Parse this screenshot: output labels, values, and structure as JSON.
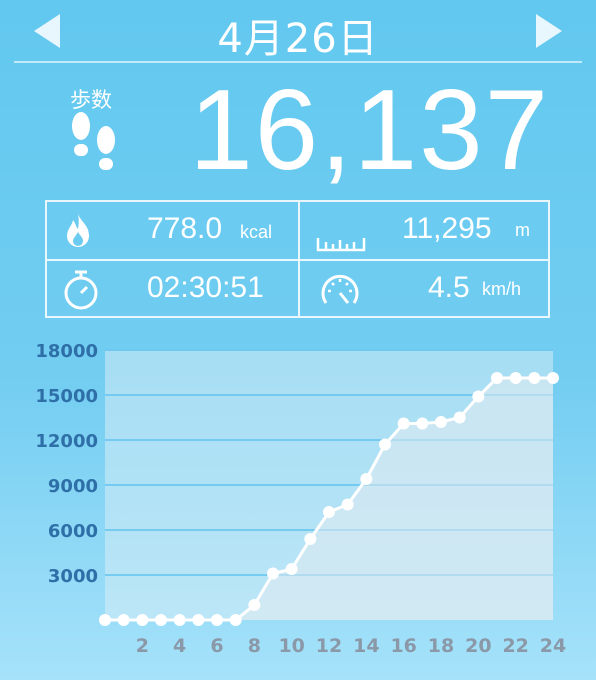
{
  "header": {
    "date": "4月26日"
  },
  "steps": {
    "label": "歩数",
    "value": "16,137"
  },
  "stats": {
    "calories": {
      "value": "778.0",
      "unit": "kcal"
    },
    "distance": {
      "value": "11,295",
      "unit": "m"
    },
    "duration": {
      "value": "02:30:51"
    },
    "speed": {
      "value": "4.5",
      "unit": "km/h"
    }
  },
  "icons": {
    "prev": "triangle-left-icon",
    "next": "triangle-right-icon",
    "steps": "footprints-icon",
    "calories": "flame-icon",
    "distance": "ruler-icon",
    "duration": "stopwatch-icon",
    "speed": "speedometer-icon"
  },
  "colors": {
    "background": "#6ccbf0",
    "line": "#ffffff",
    "yTick": "#2e6fa8",
    "xTick": "#8a98a8"
  },
  "chart_data": {
    "type": "line",
    "x": [
      0,
      1,
      2,
      3,
      4,
      5,
      6,
      7,
      8,
      9,
      10,
      11,
      12,
      13,
      14,
      15,
      16,
      17,
      18,
      19,
      20,
      21,
      22,
      23,
      24
    ],
    "x_tick_labels": [
      "2",
      "4",
      "6",
      "8",
      "10",
      "12",
      "14",
      "16",
      "18",
      "20",
      "22",
      "24"
    ],
    "y_tick_labels": [
      "3000",
      "6000",
      "9000",
      "12000",
      "15000",
      "18000"
    ],
    "series": [
      {
        "values": [
          0,
          0,
          0,
          0,
          0,
          0,
          0,
          0,
          1000,
          3100,
          3400,
          5400,
          7200,
          7700,
          9400,
          11700,
          13100,
          13100,
          13200,
          13500,
          14900,
          16137,
          16137,
          16137,
          16137
        ]
      }
    ],
    "ylim": [
      0,
      18000
    ],
    "xlim": [
      0,
      24
    ],
    "grid": true,
    "area_fill": true
  }
}
